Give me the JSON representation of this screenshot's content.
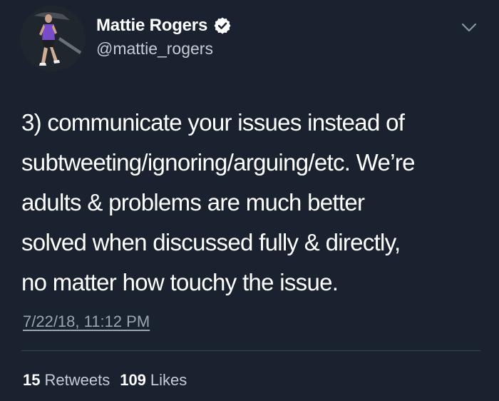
{
  "user": {
    "display_name": "Mattie Rogers",
    "handle": "@mattie_rogers",
    "verified": true
  },
  "tweet": {
    "text_lines": [
      "3) communicate your issues instead of",
      "subtweeting/ignoring/arguing/etc. We’re",
      "adults & problems are much better",
      "solved when discussed fully & directly,",
      "no matter how touchy the issue."
    ],
    "timestamp": "7/22/18, 11:12 PM"
  },
  "stats": {
    "retweets_count": "15",
    "retweets_label": "Retweets",
    "likes_count": "109",
    "likes_label": "Likes"
  },
  "icons": {
    "verified": "verified-badge-icon",
    "menu": "chevron-down-icon"
  },
  "colors": {
    "background": "#1a2230",
    "text_primary": "#ffffff",
    "text_secondary": "#c4ccd6",
    "timestamp": "#9aa5b1",
    "divider": "#3a4452"
  }
}
